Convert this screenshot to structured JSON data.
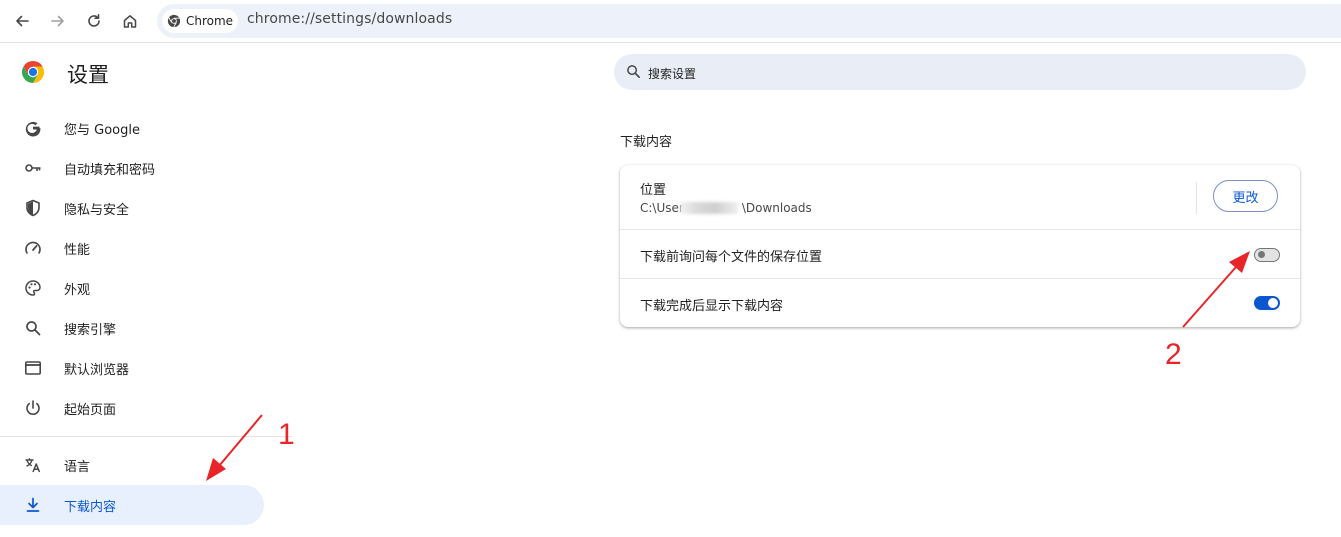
{
  "toolbar": {
    "chip_label": "Chrome",
    "url": "chrome://settings/downloads"
  },
  "sidebar": {
    "title": "设置",
    "items": [
      {
        "label": "您与 Google",
        "icon": "google-g-icon"
      },
      {
        "label": "自动填充和密码",
        "icon": "key-icon"
      },
      {
        "label": "隐私与安全",
        "icon": "shield-icon"
      },
      {
        "label": "性能",
        "icon": "speedometer-icon"
      },
      {
        "label": "外观",
        "icon": "palette-icon"
      },
      {
        "label": "搜索引擎",
        "icon": "search-icon"
      },
      {
        "label": "默认浏览器",
        "icon": "browser-window-icon"
      },
      {
        "label": "起始页面",
        "icon": "power-icon"
      },
      {
        "label": "语言",
        "icon": "translate-icon"
      },
      {
        "label": "下载内容",
        "icon": "download-icon"
      }
    ],
    "active_index": 9
  },
  "search": {
    "placeholder": "搜索设置"
  },
  "main": {
    "section_title": "下载内容",
    "location": {
      "label": "位置",
      "path_prefix": "C:\\User",
      "path_suffix": "\\Downloads",
      "change_label": "更改"
    },
    "settings": [
      {
        "label": "下载前询问每个文件的保存位置",
        "enabled": false
      },
      {
        "label": "下载完成后显示下载内容",
        "enabled": true
      }
    ]
  },
  "annotations": [
    {
      "label": "1",
      "color": "#e8262a"
    },
    {
      "label": "2",
      "color": "#e8262a"
    }
  ],
  "colors": {
    "accent": "#0b57d0",
    "active_nav_bg": "#e8f0fe",
    "annotation_red": "#e8262a"
  }
}
